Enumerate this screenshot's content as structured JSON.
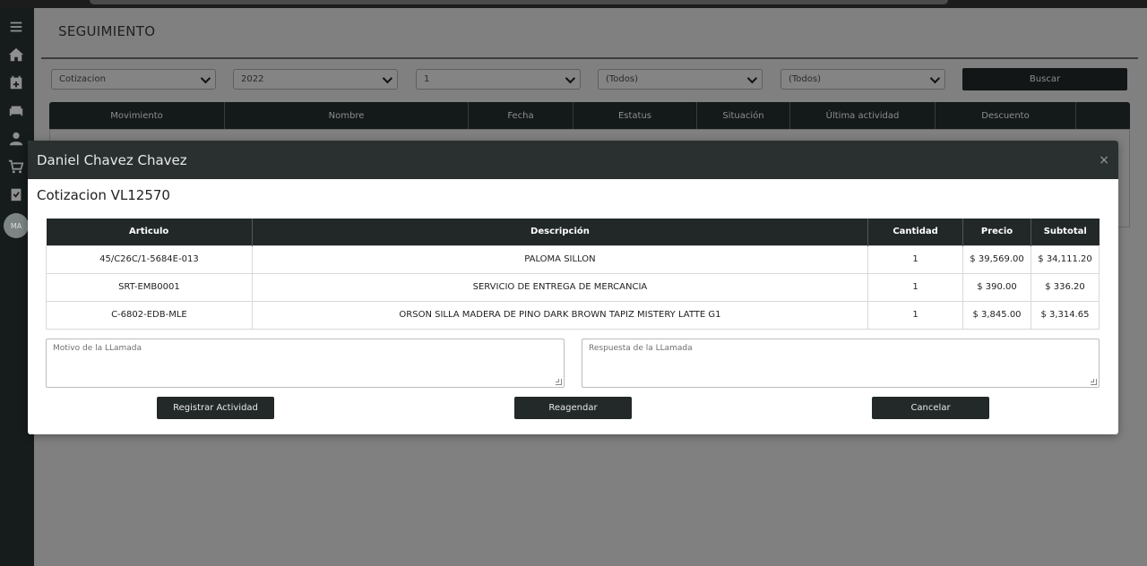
{
  "page": {
    "title": "SEGUIMIENTO"
  },
  "sidebar": {
    "icons": [
      "menu-icon",
      "home-icon",
      "calendar-icon",
      "sofa-icon",
      "user-icon",
      "cart-icon",
      "clipboard-check-icon"
    ],
    "avatar_text": "MA"
  },
  "filters": {
    "type": "Cotizacion",
    "year": "2022",
    "month": "1",
    "status": "(Todos)",
    "situation": "(Todos)",
    "search_label": "Buscar"
  },
  "grid": {
    "columns": [
      "Movimiento",
      "Nombre",
      "Fecha",
      "Estatus",
      "Situación",
      "Última actividad",
      "Descuento",
      ""
    ]
  },
  "modal": {
    "title": "Daniel Chavez Chavez",
    "close_symbol": "×",
    "quote_title": "Cotizacion VL12570",
    "columns": [
      "Articulo",
      "Descripción",
      "Cantidad",
      "Precio",
      "Subtotal"
    ],
    "rows": [
      [
        "45/C26C/1-5684E-013",
        "PALOMA SILLON",
        "1",
        "$ 39,569.00",
        "$ 34,111.20"
      ],
      [
        "SRT-EMB0001",
        "SERVICIO DE ENTREGA DE MERCANCIA",
        "1",
        "$ 390.00",
        "$ 336.20"
      ],
      [
        "C-6802-EDB-MLE",
        "ORSON SILLA MADERA DE PINO DARK BROWN TAPIZ MISTERY LATTE G1",
        "1",
        "$ 3,845.00",
        "$ 3,314.65"
      ]
    ],
    "call_reason_placeholder": "Motivo de la LLamada",
    "call_response_placeholder": "Respuesta de la LLamada",
    "register_label": "Registrar Actividad",
    "reschedule_label": "Reagendar",
    "cancel_label": "Cancelar"
  },
  "colors": {
    "dark": "#222828",
    "overlay": "#808080"
  }
}
